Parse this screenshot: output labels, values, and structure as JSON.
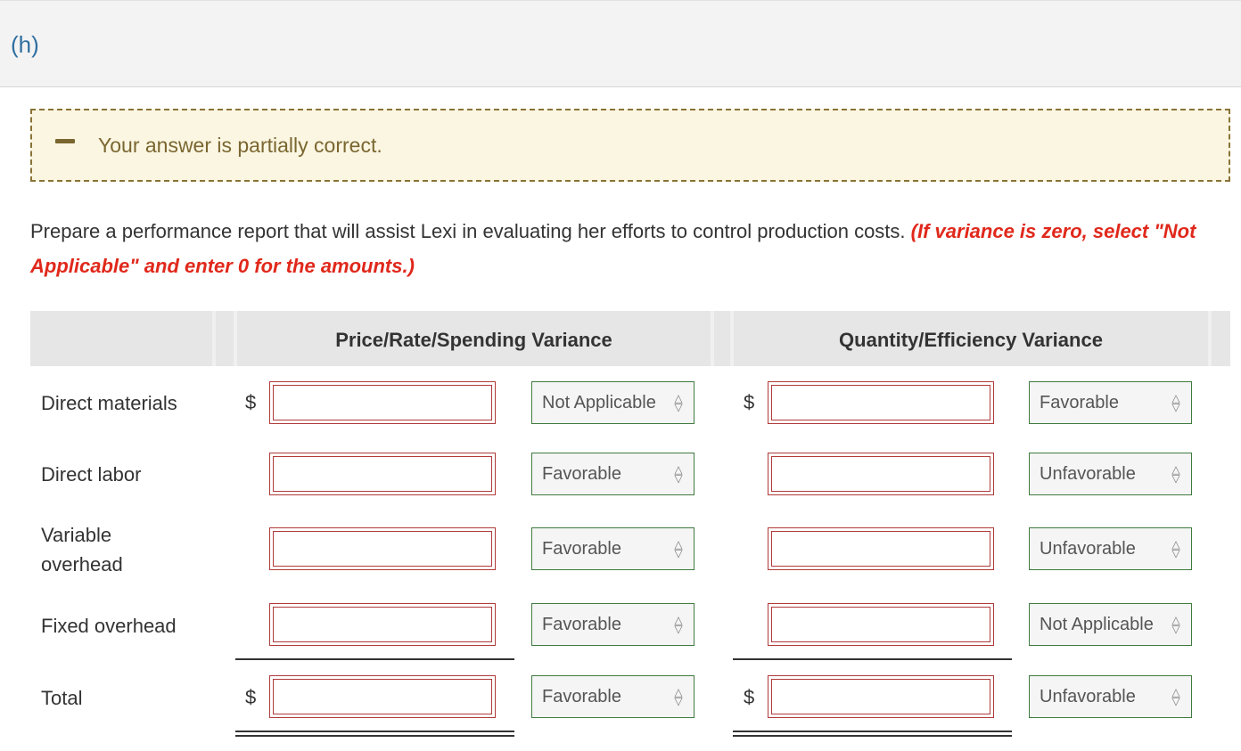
{
  "part": {
    "label": "(h)"
  },
  "feedback": {
    "text": "Your answer is partially correct."
  },
  "instructions": {
    "text": "Prepare a performance report that will assist Lexi in evaluating her efforts to control production costs. ",
    "emphasis": "(If variance is zero, select \"Not Applicable\" and enter 0 for the amounts.)"
  },
  "table": {
    "headers": {
      "price": "Price/Rate/Spending Variance",
      "quantity": "Quantity/Efficiency Variance"
    },
    "currency": "$",
    "rows": [
      {
        "label": "Direct materials",
        "price_amount": "",
        "price_type": "Not Applicable",
        "quantity_amount": "",
        "quantity_type": "Favorable"
      },
      {
        "label": "Direct labor",
        "price_amount": "",
        "price_type": "Favorable",
        "quantity_amount": "",
        "quantity_type": "Unfavorable"
      },
      {
        "label": "Variable overhead",
        "price_amount": "",
        "price_type": "Favorable",
        "quantity_amount": "",
        "quantity_type": "Unfavorable"
      },
      {
        "label": "Fixed overhead",
        "price_amount": "",
        "price_type": "Favorable",
        "quantity_amount": "",
        "quantity_type": "Not Applicable"
      },
      {
        "label": "Total",
        "price_amount": "",
        "price_type": "Favorable",
        "quantity_amount": "",
        "quantity_type": "Unfavorable"
      }
    ]
  },
  "colors": {
    "link_blue": "#2f6fa1",
    "warning_text": "#7a6630",
    "warning_bg": "#fbf6e2",
    "emphasis_red": "#e0281b",
    "input_border": "#b03a3a",
    "select_border": "#3f7a3f"
  }
}
